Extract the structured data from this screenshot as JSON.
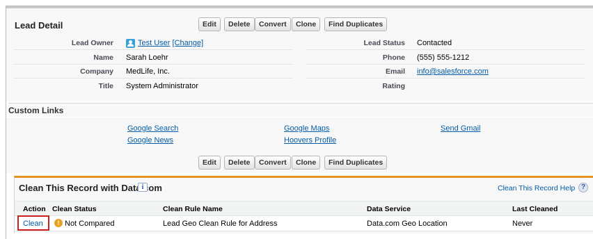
{
  "detail": {
    "title": "Lead Detail",
    "buttons": [
      "Edit",
      "Delete",
      "Convert",
      "Clone",
      "Find Duplicates"
    ],
    "fields": {
      "lead_owner_label": "Lead Owner",
      "lead_owner_value": "Test User",
      "change_link": "[Change]",
      "name_label": "Name",
      "name_value": "Sarah Loehr",
      "company_label": "Company",
      "company_value": "MedLife, Inc.",
      "title_label": "Title",
      "title_value": "System Administrator",
      "lead_status_label": "Lead Status",
      "lead_status_value": "Contacted",
      "phone_label": "Phone",
      "phone_value": "(555) 555-1212",
      "email_label": "Email",
      "email_value": "info@salesforce.com",
      "rating_label": "Rating",
      "rating_value": ""
    }
  },
  "custom_links": {
    "title": "Custom Links",
    "links": [
      "Google Search",
      "Google News",
      "Google Maps",
      "Hoovers Profile",
      "Send Gmail"
    ]
  },
  "clean": {
    "title": "Clean This Record with Data.com",
    "info_icon": "i",
    "help_link": "Clean This Record Help",
    "help_icon": "?",
    "headers": [
      "Action",
      "Clean Status",
      "Clean Rule Name",
      "Data Service",
      "Last Cleaned"
    ],
    "row": {
      "action": "Clean",
      "status_icon": "!",
      "status": "Not Compared",
      "rule": "Lead Geo Clean Rule for Address",
      "service": "Data.com Geo Location",
      "last_cleaned": "Never"
    }
  },
  "colors": {
    "link": "#015ba7",
    "clean_section_accent": "#e39321",
    "highlight_box": "#cc1f1f"
  }
}
